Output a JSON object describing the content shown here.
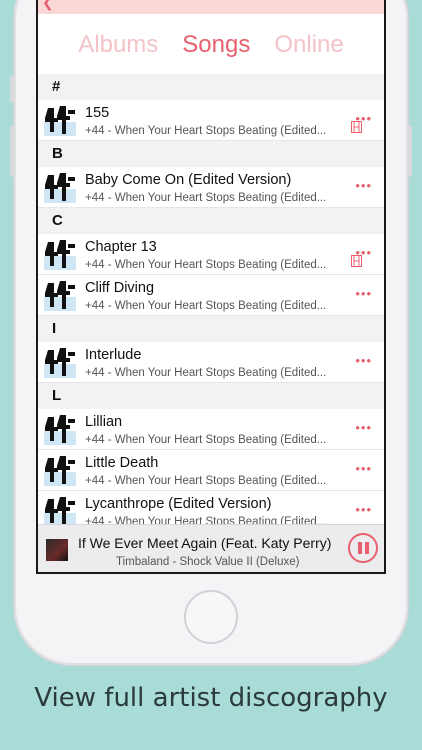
{
  "segments": [
    {
      "label": "Albums",
      "active": false
    },
    {
      "label": "Songs",
      "active": true
    },
    {
      "label": "Online",
      "active": false
    }
  ],
  "sections": [
    {
      "header": "#",
      "rows": [
        {
          "title": "155",
          "subtitle": "+44 - When Your Heart Stops Beating (Edited...",
          "has_video_icon": true
        }
      ]
    },
    {
      "header": "B",
      "rows": [
        {
          "title": "Baby Come On (Edited Version)",
          "subtitle": "+44 - When Your Heart Stops Beating (Edited...",
          "has_video_icon": false
        }
      ]
    },
    {
      "header": "C",
      "rows": [
        {
          "title": "Chapter 13",
          "subtitle": "+44 - When Your Heart Stops Beating (Edited...",
          "has_video_icon": true
        },
        {
          "title": "Cliff Diving",
          "subtitle": "+44 - When Your Heart Stops Beating (Edited...",
          "has_video_icon": false
        }
      ]
    },
    {
      "header": "I",
      "rows": [
        {
          "title": "Interlude",
          "subtitle": "+44 - When Your Heart Stops Beating (Edited...",
          "has_video_icon": false
        }
      ]
    },
    {
      "header": "L",
      "rows": [
        {
          "title": "Lillian",
          "subtitle": "+44 - When Your Heart Stops Beating (Edited...",
          "has_video_icon": false
        },
        {
          "title": "Little Death",
          "subtitle": "+44 - When Your Heart Stops Beating (Edited...",
          "has_video_icon": false
        },
        {
          "title": "Lycanthrope (Edited Version)",
          "subtitle": "+44 - When Your Heart Stops Beating (Edited...",
          "has_video_icon": false
        }
      ]
    }
  ],
  "more_glyph": "•••",
  "now_playing": {
    "title": "If We Ever Meet Again (Feat. Katy Perry)",
    "subtitle": "Timbaland - Shock Value II (Deluxe)"
  },
  "caption": "View full artist discography",
  "colors": {
    "accent": "#e8606d",
    "accent_light": "#f2c3c7",
    "navbar": "#fbd8d6",
    "background": "#a9dcd6"
  },
  "icons": {
    "back": "chevron-left-icon",
    "more": "more-dots-icon",
    "video": "film-strip-icon",
    "pause": "pause-icon",
    "album_art": "album-art-44-icon"
  }
}
